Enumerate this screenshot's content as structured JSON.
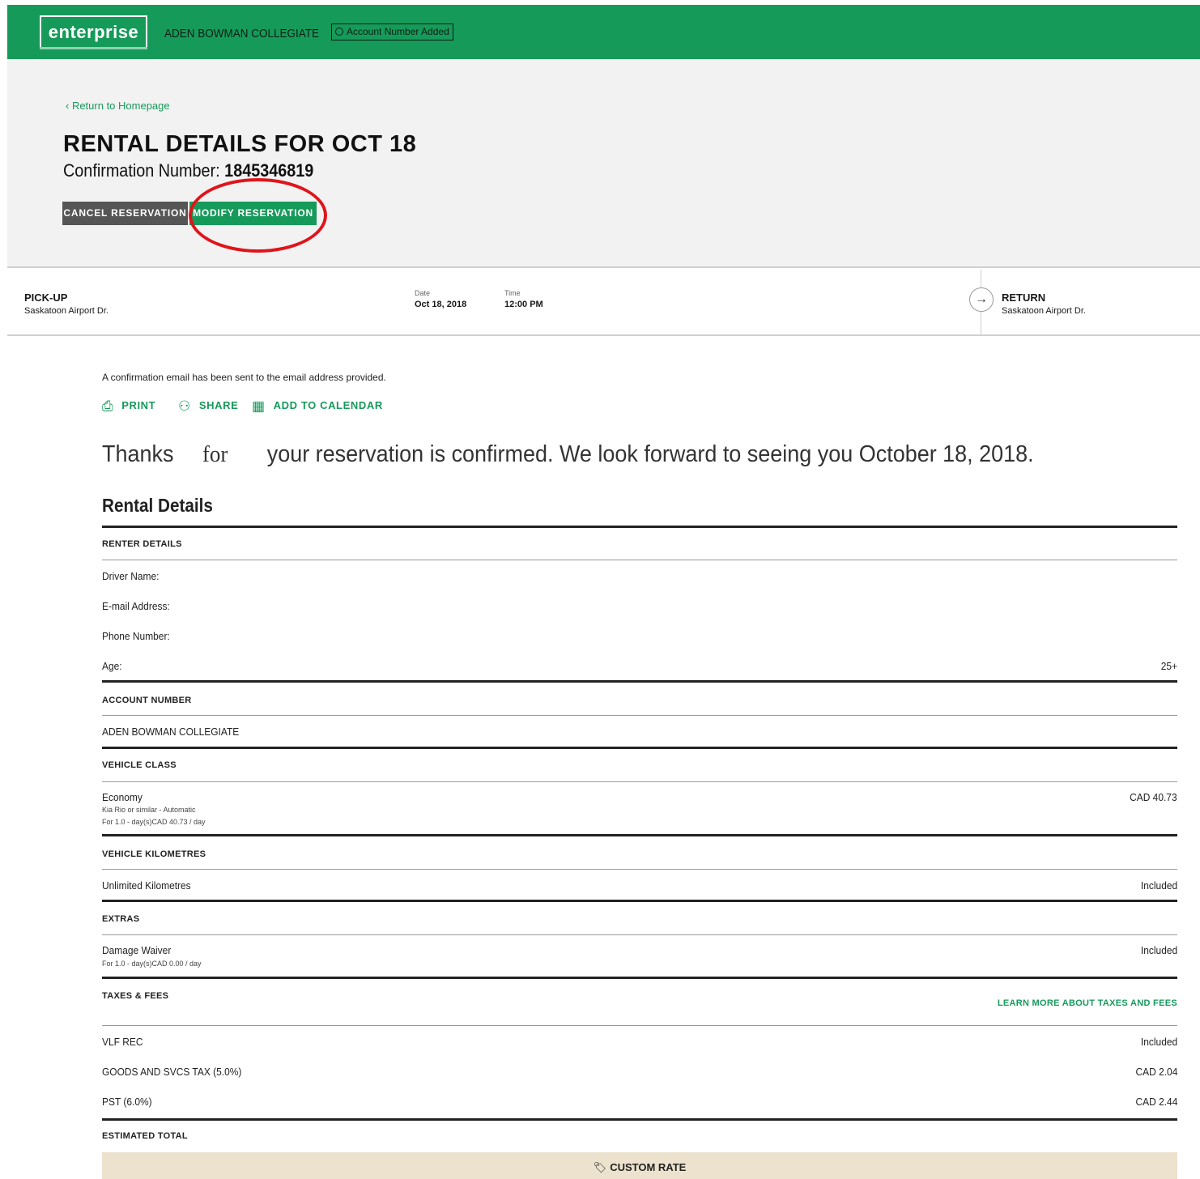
{
  "header": {
    "logo_text": "enterprise",
    "org_name": "ADEN BOWMAN COLLEGIATE",
    "account_badge": "Account Number Added",
    "brand_color": "#169a5a"
  },
  "hero": {
    "return_link": "‹ Return to Homepage",
    "title": "RENTAL DETAILS FOR OCT 18",
    "confirmation_label": "Confirmation Number: ",
    "confirmation_number": "1845346819",
    "cancel_button": "CANCEL RESERVATION",
    "modify_button": "MODIFY RESERVATION"
  },
  "trip": {
    "pickup_label": "PICK-UP",
    "pickup_location": "Saskatoon Airport Dr.",
    "date_label": "Date",
    "date_value": "Oct 18, 2018",
    "time_label": "Time",
    "time_value": "12:00 PM",
    "return_label": "RETURN",
    "return_location": "Saskatoon Airport Dr."
  },
  "content": {
    "email_note": "A confirmation email has been sent to the email address provided.",
    "print": "PRINT",
    "share": "SHARE",
    "calendar": "ADD TO CALENDAR",
    "thanks_a": "Thanks",
    "thanks_for": "for",
    "thanks_b": "your reservation is confirmed. We look forward to seeing you October 18, 2018.",
    "section_title": "Rental Details"
  },
  "details": {
    "renter_head": "RENTER DETAILS",
    "driver_label": "Driver Name:",
    "email_label": "E-mail Address:",
    "phone_label": "Phone Number:",
    "age_label": "Age:",
    "age_value": "25+",
    "account_head": "ACCOUNT NUMBER",
    "account_value": "ADEN BOWMAN COLLEGIATE",
    "vehicle_head": "VEHICLE CLASS",
    "vehicle_name": "Economy",
    "vehicle_sub1": "Kia Rio or similar - Automatic",
    "vehicle_sub2": "For 1.0 - day(s)CAD 40.73 / day",
    "vehicle_price": "CAD 40.73",
    "km_head": "VEHICLE KILOMETRES",
    "km_label": "Unlimited Kilometres",
    "km_value": "Included",
    "extras_head": "EXTRAS",
    "damage_label": "Damage Waiver",
    "damage_sub": "For 1.0 - day(s)CAD 0.00 / day",
    "damage_value": "Included",
    "taxes_head": "TAXES & FEES",
    "learn_more": "LEARN MORE ABOUT TAXES AND FEES",
    "vlf_label": "VLF REC",
    "vlf_value": "Included",
    "gst_label": "GOODS AND SVCS TAX (5.0%)",
    "gst_value": "CAD 2.04",
    "pst_label": "PST (6.0%)",
    "pst_value": "CAD 2.44",
    "total_head": "ESTIMATED TOTAL",
    "custom_rate": "CUSTOM RATE"
  }
}
